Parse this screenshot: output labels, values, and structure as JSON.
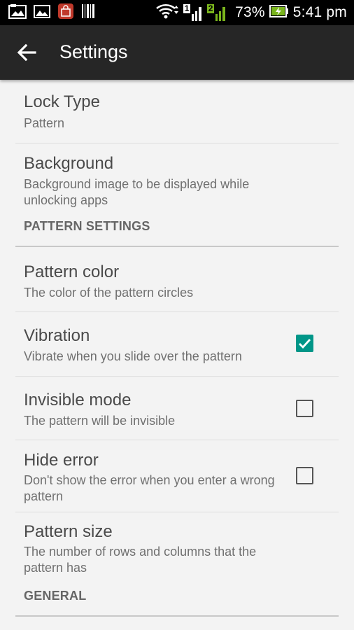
{
  "status_bar": {
    "battery_percent": "73%",
    "time": "5:41 pm",
    "sim1_label": "1",
    "sim2_label": "2",
    "icons": [
      "photo-notification-icon",
      "image-notification-icon",
      "shopping-bag-icon",
      "barcode-icon",
      "wifi-icon",
      "sim1-signal-icon",
      "sim2-signal-icon",
      "battery-charging-icon"
    ],
    "colors": {
      "sim2": "#7ab51d",
      "battery": "#7ab51d",
      "shopping_bag": "#c0392b"
    }
  },
  "toolbar": {
    "title": "Settings",
    "back_icon": "arrow-back-icon"
  },
  "preferences": {
    "lock_type": {
      "title": "Lock Type",
      "summary": "Pattern"
    },
    "background": {
      "title": "Background",
      "summary": "Background image to be displayed while unlocking apps"
    },
    "pattern_category": {
      "label": "PATTERN SETTINGS"
    },
    "pattern_color": {
      "title": "Pattern color",
      "summary": "The color of the pattern circles"
    },
    "vibration": {
      "title": "Vibration",
      "summary": "Vibrate when you slide over the pattern",
      "checked": true
    },
    "invisible_mode": {
      "title": "Invisible mode",
      "summary": "The pattern will be invisible",
      "checked": false
    },
    "hide_error": {
      "title": "Hide error",
      "summary": "Don't show the error when you enter a wrong pattern",
      "checked": false
    },
    "pattern_size": {
      "title": "Pattern size",
      "summary": "The number of rows and columns that the pattern has"
    },
    "general_category": {
      "label": "GENERAL"
    }
  },
  "colors": {
    "accent": "#009688",
    "toolbar": "#262626",
    "background": "#f3f3f3"
  }
}
